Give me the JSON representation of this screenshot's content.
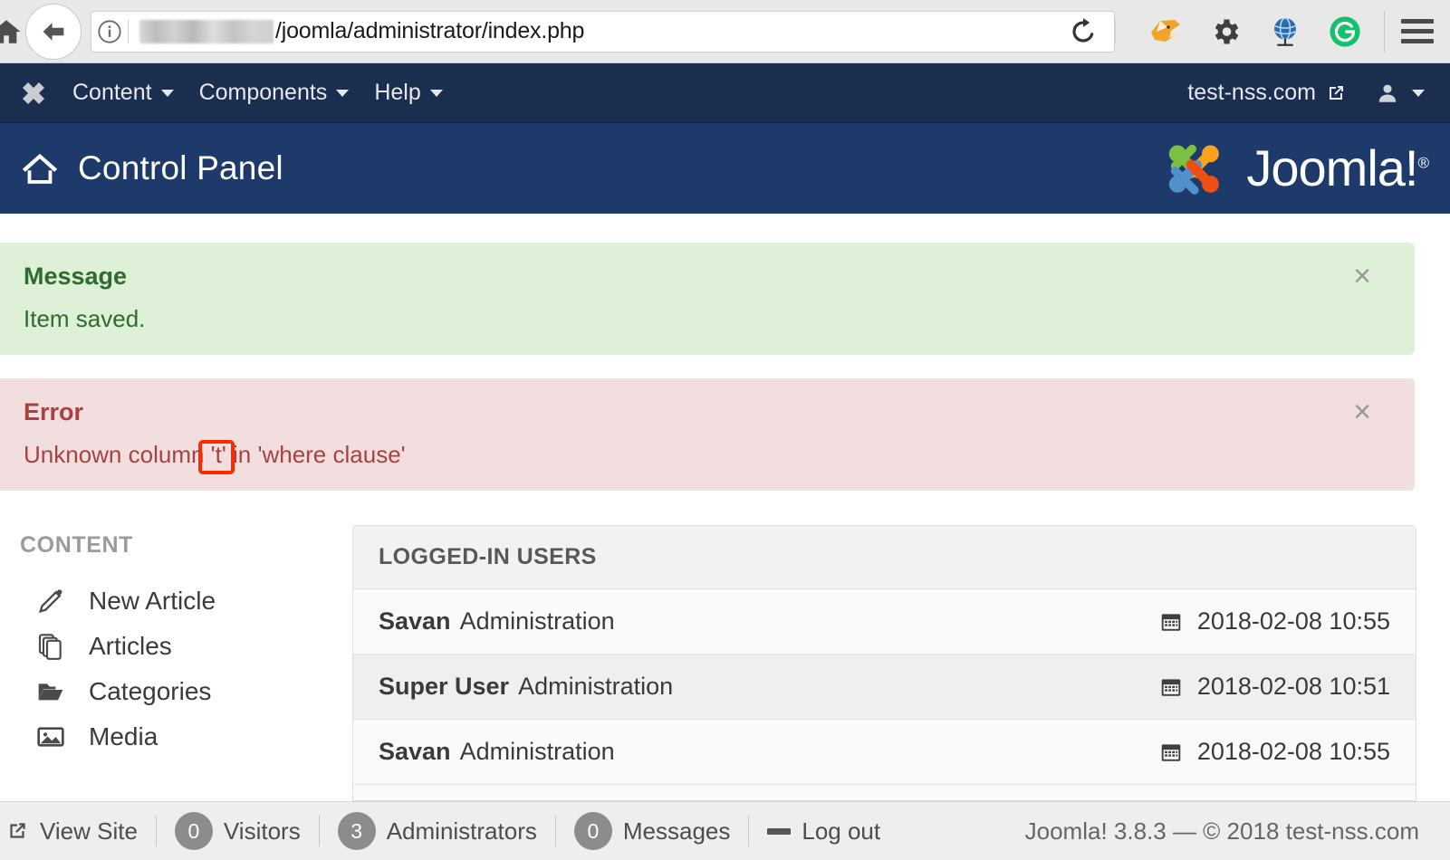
{
  "browser": {
    "home_icon": "home-icon",
    "back_icon": "back-arrow-icon",
    "info_icon": "info-circle-icon",
    "url_visible_text": "/joomla/administrator/index.php",
    "url_redacted": true,
    "reload_icon": "reload-icon",
    "extensions": [
      {
        "name": "origami-fox-extension-icon"
      },
      {
        "name": "gear-icon"
      },
      {
        "name": "globe-network-icon"
      },
      {
        "name": "grammarly-icon",
        "color": "#15c26b",
        "letter": "G"
      }
    ],
    "menu_icon": "hamburger-menu-icon"
  },
  "topnav": {
    "brand_icon": "joomla-logo-icon",
    "items": [
      {
        "label": "Content",
        "has_dropdown": true
      },
      {
        "label": "Components",
        "has_dropdown": true
      },
      {
        "label": "Help",
        "has_dropdown": true
      }
    ],
    "site_link": "test-nss.com",
    "site_link_icon": "external-link-icon",
    "user_icon": "user-icon",
    "user_caret": "chevron-down-icon"
  },
  "page_header": {
    "home_icon": "home-outline-icon",
    "title": "Control Panel",
    "logo_text": "Joomla!",
    "logo_reg": "®"
  },
  "alerts": [
    {
      "type": "success",
      "heading": "Message",
      "body": "Item saved.",
      "close_label": "×",
      "bg": "#dff0d8",
      "fg": "#2f6a31"
    },
    {
      "type": "error",
      "heading": "Error",
      "body": "Unknown column 't' in 'where clause'",
      "close_label": "×",
      "bg": "#f2dede",
      "fg": "#a8423f"
    }
  ],
  "annotation": {
    "target_text": "'t'",
    "color": "#fb2a00"
  },
  "sidebar": {
    "title": "CONTENT",
    "items": [
      {
        "label": "New Article",
        "icon": "pencil-icon"
      },
      {
        "label": "Articles",
        "icon": "copy-pages-icon"
      },
      {
        "label": "Categories",
        "icon": "folder-open-icon"
      },
      {
        "label": "Media",
        "icon": "image-icon"
      }
    ]
  },
  "panel": {
    "title": "LOGGED-IN USERS",
    "rows": [
      {
        "name": "Savan",
        "group": "Administration",
        "date": "2018-02-08 10:55",
        "date_icon": "calendar-icon"
      },
      {
        "name": "Super User",
        "group": "Administration",
        "date": "2018-02-08 10:51",
        "date_icon": "calendar-icon"
      },
      {
        "name": "Savan",
        "group": "Administration",
        "date": "2018-02-08 10:55",
        "date_icon": "calendar-icon"
      }
    ]
  },
  "statusbar": {
    "view_site": "View Site",
    "view_site_icon": "external-site-icon",
    "visitors_count": "0",
    "visitors_label": "Visitors",
    "admins_count": "3",
    "admins_label": "Administrators",
    "messages_count": "0",
    "messages_label": "Messages",
    "logout_label": "Log out",
    "logout_icon": "logout-dash-icon",
    "copyright": "Joomla! 3.8.3  —  © 2018 test-nss.com"
  }
}
